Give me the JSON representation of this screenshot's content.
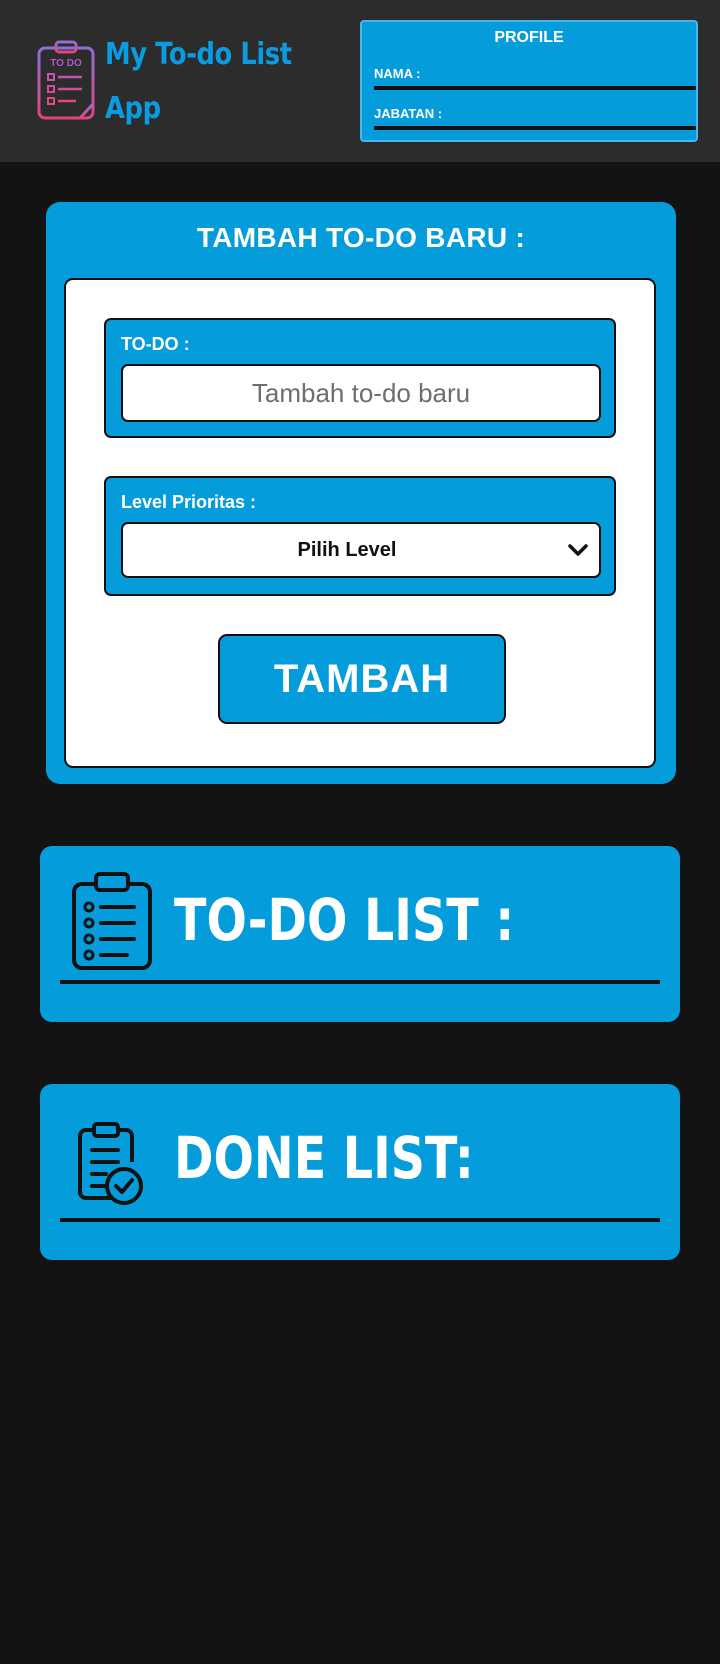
{
  "header": {
    "app_title": "My To-do List App",
    "logo_icon": "todo-clipboard-icon",
    "logo_text": "TO DO"
  },
  "profile": {
    "title": "PROFILE",
    "nama_label": "NAMA :",
    "jabatan_label": "JABATAN :"
  },
  "add_form": {
    "title": "TAMBAH TO-DO BARU :",
    "todo_label": "TO-DO :",
    "todo_placeholder": "Tambah to-do baru",
    "todo_value": "",
    "level_label": "Level Prioritas :",
    "level_selected": "Pilih Level",
    "submit_label": "TAMBAH"
  },
  "todo_list": {
    "title": "TO-DO LIST :",
    "icon": "clipboard-list-icon",
    "items": []
  },
  "done_list": {
    "title": "DONE LIST:",
    "icon": "clipboard-check-icon",
    "items": []
  },
  "colors": {
    "page_background": "#131313",
    "header_background": "#2c2c2c",
    "accent": "#049cda",
    "title_blue": "#0a9be0",
    "text_on_accent": "#ffffff",
    "border": "#111111"
  }
}
